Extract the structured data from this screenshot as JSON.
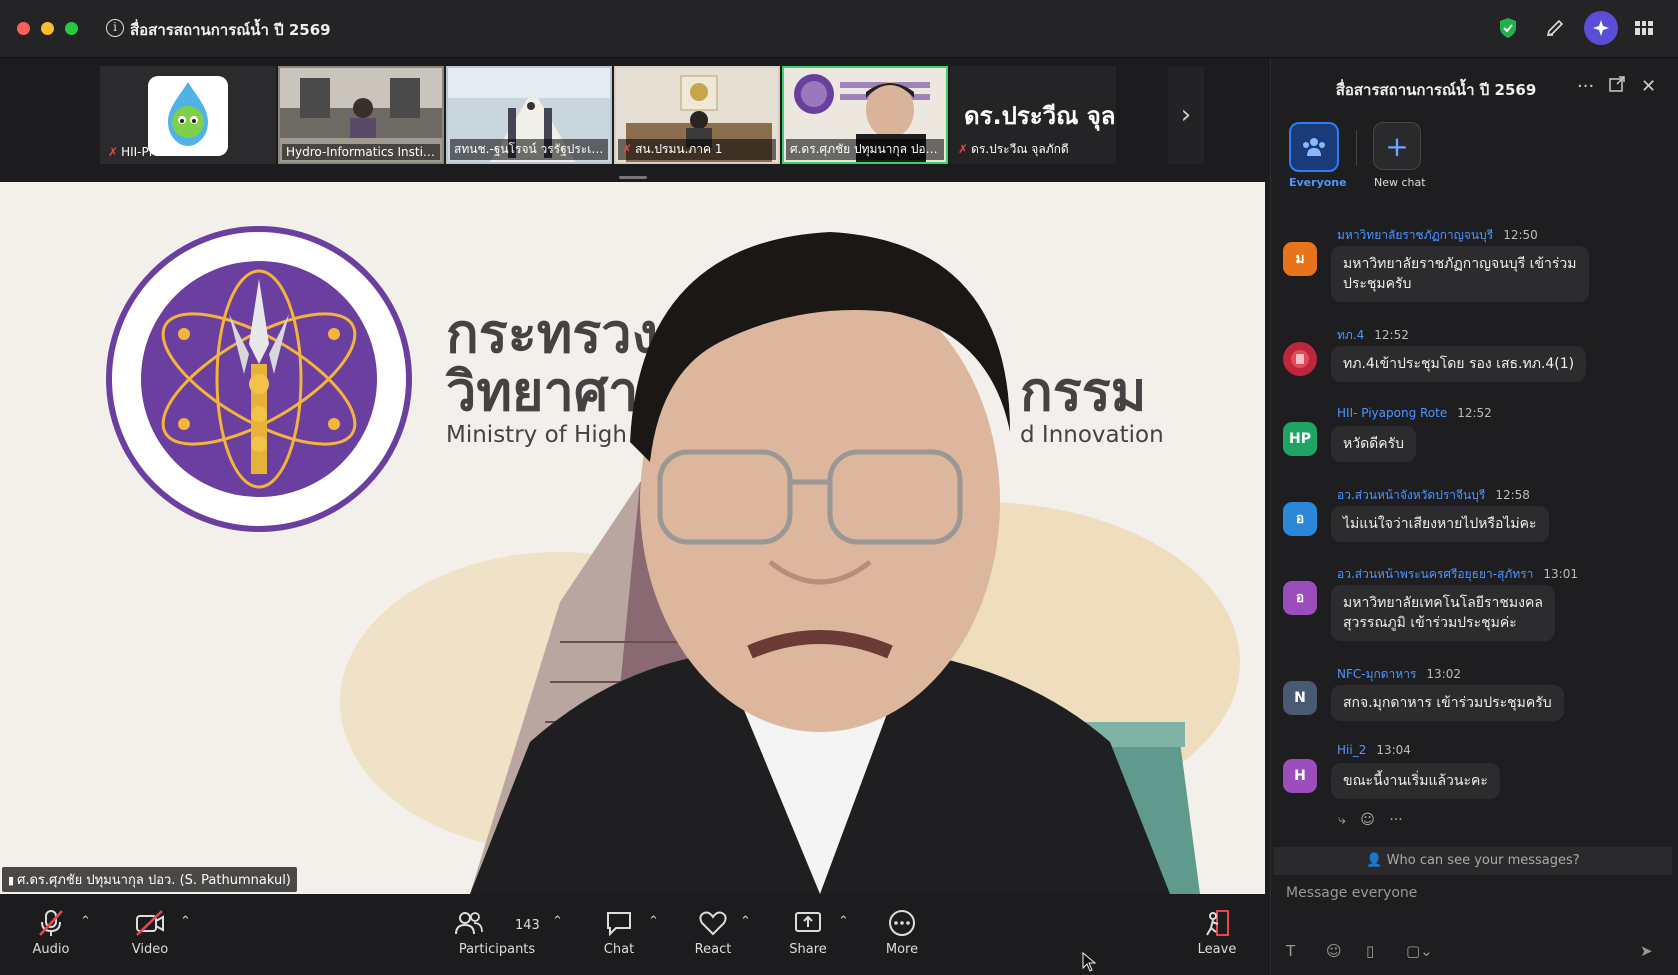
{
  "window": {
    "title": "สื่อสารสถานการณ์น้ำ ปี 2569"
  },
  "thumbnails": [
    {
      "name": "HII-PR",
      "muted": true
    },
    {
      "name": "Hydro-Informatics Institu...",
      "muted": false
    },
    {
      "name": "สทนช.-ฐนโรจน์ วรรัฐประเสริฐ",
      "muted": false
    },
    {
      "name": "สน.ปรมน.ภาค 1",
      "muted": true
    },
    {
      "name": "ศ.ดร.ศุภชัย ปทุมนากุล ปอว....",
      "muted": false,
      "active": true
    },
    {
      "name": "ดร.ประวีณ จุลภักดี",
      "muted": true,
      "display_text": "ดร.ประวีณ จุล..."
    }
  ],
  "main_video": {
    "speaker_label": "ศ.ดร.ศุภชัย ปทุมนากุล ปอว. (S. Pathumnakul)",
    "backdrop_line1": "กระทรวง",
    "backdrop_line2": "วิทยาศา",
    "backdrop_line2_end": "กรรม",
    "backdrop_english": "Ministry of High",
    "backdrop_english_end": "d Innovation"
  },
  "toolbar": {
    "audio_label": "Audio",
    "video_label": "Video",
    "participants_label": "Participants",
    "participants_count": "143",
    "chat_label": "Chat",
    "react_label": "React",
    "share_label": "Share",
    "more_label": "More",
    "leave_label": "Leave"
  },
  "chat": {
    "title": "สื่อสารสถานการณ์น้ำ ปี 2569",
    "tab_everyone": "Everyone",
    "tab_new_chat": "New chat",
    "messages": [
      {
        "sender": "มหาวิทยาลัยราชภัฏกาญจนบุรี",
        "time": "12:50",
        "initial": "ม",
        "color": "#e8731a",
        "text_line1": "มหาวิทยาลัยราชภัฏกาญจนบุรี เข้าร่วม",
        "text_line2": "ประชุมครับ"
      },
      {
        "sender": "ทภ.4",
        "time": "12:52",
        "initial": "",
        "color": "#c0263a",
        "text_line1": "ทภ.4เข้าประชุมโดย รอง เสธ.ทภ.4(1)",
        "text_line2": ""
      },
      {
        "sender": "HII- Piyapong Rote",
        "time": "12:52",
        "initial": "HP",
        "color": "#1fa463",
        "text_line1": "หวัดดีครับ",
        "text_line2": ""
      },
      {
        "sender": "อว.ส่วนหน้าจังหวัดปราจีนบุรี",
        "time": "12:58",
        "initial": "อ",
        "color": "#2b88d8",
        "text_line1": "ไม่แน่ใจว่าเสียงหายไปหรือไม่คะ",
        "text_line2": ""
      },
      {
        "sender": "อว.ส่วนหน้าพระนครศรีอยุธยา-สุภัทรา",
        "time": "13:01",
        "initial": "อ",
        "color": "#9b4dbd",
        "text_line1": "มหาวิทยาลัยเทคโนโลยีราชมงคล",
        "text_line2": "สุวรรณภูมิ เข้าร่วมประชุมค่ะ"
      },
      {
        "sender": "NFC-มุกดาหาร",
        "time": "13:02",
        "initial": "N",
        "color": "#4a5a72",
        "text_line1": "สกจ.มุกดาหาร เข้าร่วมประชุมครับ",
        "text_line2": ""
      },
      {
        "sender": "Hii_2",
        "time": "13:04",
        "initial": "H",
        "color": "#9b4dbd",
        "text_line1": "ขณะนี้งานเริ่มแล้วนะคะ",
        "text_line2": ""
      }
    ],
    "visibility_text": "Who can see your messages?",
    "input_placeholder": "Message everyone"
  },
  "colors": {
    "accent": "#2d7df6",
    "active_border": "#3ccf6a",
    "mute_red": "#e5484d",
    "mhesi_purple": "#6b3fa0"
  }
}
